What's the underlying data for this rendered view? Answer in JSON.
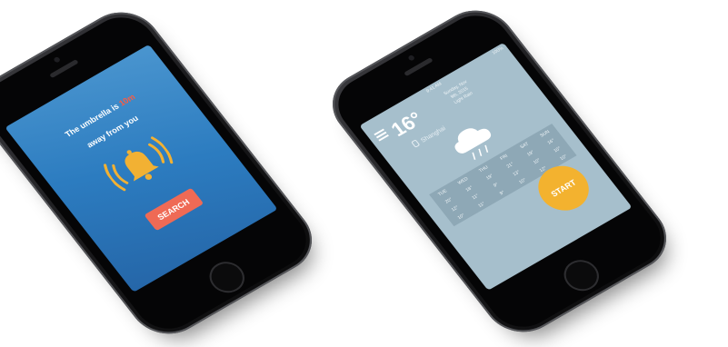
{
  "left_screen": {
    "message_line1_prefix": "The  umbrella is",
    "message_line1_highlight": "10m",
    "message_line2": "away from you",
    "search_label": "SEARCH",
    "colors": {
      "background": "#2c7cc0",
      "button": "#ef6a55",
      "bell": "#f2b133",
      "highlight": "#ff5b3f"
    },
    "icon": "bell-icon"
  },
  "right_screen": {
    "status_time": "9:41 AM",
    "status_battery": "100%",
    "temperature": "16°",
    "info_lines": [
      "Sunday, Nov",
      "9th, 2015",
      "Light Rain"
    ],
    "location": "Shanghai",
    "weather_icon": "rain-cloud-icon",
    "forecast": {
      "days": [
        "TUE",
        "WED",
        "THU",
        "FRI",
        "SAT",
        "SUN"
      ],
      "highs": [
        "20°",
        "18°",
        "19°",
        "21°",
        "19°",
        "16°"
      ],
      "lows": [
        "12°",
        "11°",
        "9°",
        "13°",
        "10°",
        "10°"
      ],
      "extra": [
        "10°",
        "11°",
        "9°",
        "10°",
        "12°",
        "10°"
      ]
    },
    "start_label": "START",
    "colors": {
      "background": "#a6bfcc",
      "table": "#8ea8b6",
      "button": "#f3b22f"
    }
  }
}
